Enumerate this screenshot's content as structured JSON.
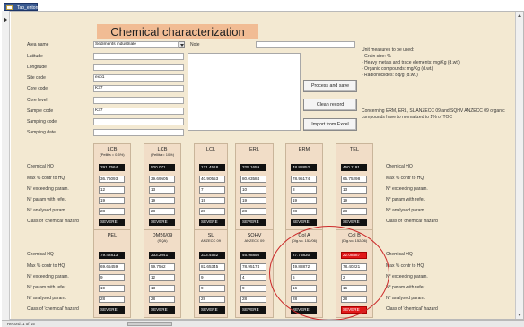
{
  "window": {
    "tab_title": "Tab_entorn"
  },
  "form": {
    "title": "Chemical characterization",
    "fields": [
      {
        "label": "Area name",
        "value": "Sediments industriale"
      },
      {
        "label": "Latitude",
        "value": ""
      },
      {
        "label": "Longitude",
        "value": ""
      },
      {
        "label": "Site code",
        "value": "exp1"
      },
      {
        "label": "Core code",
        "value": "K37"
      },
      {
        "label": "Core level",
        "value": ""
      },
      {
        "label": "Sample code",
        "value": "K37"
      },
      {
        "label": "Sampling code",
        "value": ""
      },
      {
        "label": "Sampling date",
        "value": ""
      }
    ],
    "note_label": "Note",
    "note_value": "",
    "buttons": {
      "process": "Process and save",
      "clean": "Clean record",
      "import": "Import from Excel"
    },
    "units_note": {
      "title": "Unit measures to be used:",
      "lines": [
        "- Grain size: %",
        "- Heavy metals and trace elements: mg/Kg (d.wt.)",
        "- Organic compounds: mg/Kg (d.wt.)",
        "- Radionuclides: Bq/g (d.wt.)"
      ]
    },
    "concern_note": "Concerning ERM, ERL, SL ANZECC 09 and SQHV ANZECC 09 organic compounds have to normalized to 1% of TOC"
  },
  "row_labels": [
    "Chemical HQ",
    "Max % contr to HQ",
    "N° exceeding param.",
    "N° param with refer.",
    "N° analysed param.",
    "Class of 'chemical' hazard"
  ],
  "right_labels": [
    "Chemical HQ",
    "Max % contr to HQ",
    "N° exceeding param.",
    "N° param with refer.",
    "N° analysed param.",
    "Class of 'chemical' hazard"
  ],
  "top_columns": [
    {
      "name": "LCB",
      "sub": "(Pellita = 0.5%)",
      "values": [
        "291.7564",
        "36.76093",
        "12",
        "19",
        "28",
        "SEVERE"
      ]
    },
    {
      "name": "LCB",
      "sub": "(Pellita = 10%)",
      "values": [
        "500.071",
        "39.69505",
        "13",
        "19",
        "28",
        "SEVERE"
      ]
    },
    {
      "name": "LCL",
      "sub": "",
      "values": [
        "121.4518",
        "40.90553",
        "7",
        "19",
        "28",
        "SEVERE"
      ]
    },
    {
      "name": "ERL",
      "sub": "",
      "values": [
        "325.1659",
        "80.03584",
        "10",
        "19",
        "28",
        "SEVERE"
      ]
    },
    {
      "name": "ERM",
      "sub": "",
      "values": [
        "48.88852",
        "78.95174",
        "8",
        "19",
        "28",
        "SEVERE"
      ]
    },
    {
      "name": "TEL",
      "sub": "",
      "values": [
        "450.1191",
        "65.75298",
        "13",
        "19",
        "28",
        "SEVERE"
      ]
    }
  ],
  "bottom_columns": [
    {
      "name": "PEL",
      "sub": "",
      "values": [
        "79.42813",
        "69.65459",
        "9",
        "19",
        "28",
        "SEVERE"
      ]
    },
    {
      "name": "DM56/09",
      "sub": "(SQA)",
      "values": [
        "333.2041",
        "59.7562",
        "12",
        "13",
        "28",
        "SEVERE"
      ]
    },
    {
      "name": "SL",
      "sub": "ANZECC 09",
      "values": "333.4552|82.65345|9|9|28|SEVERE"
    },
    {
      "name": "SQHV",
      "sub": "ANZECC 09",
      "values": [
        "46.98850",
        "78.95174",
        "4",
        "9",
        "28",
        "SEVERE"
      ]
    },
    {
      "name": "Col A",
      "sub": "(Dig.vo. 152/06)",
      "values": [
        "27.75830",
        "49.88872",
        "5",
        "16",
        "28",
        "SEVERE"
      ]
    },
    {
      "name": "Col B",
      "sub": "(Dig.vo. 152/06)",
      "values": [
        "22.08887",
        "78.40221",
        "2",
        "16",
        "28",
        "SEVERE"
      ]
    }
  ],
  "statusbar": {
    "nav": "Record: 1 of 15"
  },
  "colors": {
    "form_bg": "#f3e9d2",
    "title_bg": "#f1bc94",
    "column_bg": "#f1ddc7",
    "hazard_dark": "#111111",
    "hazard_red": "#e01818",
    "highlight_circle": "#cc2a2a"
  }
}
